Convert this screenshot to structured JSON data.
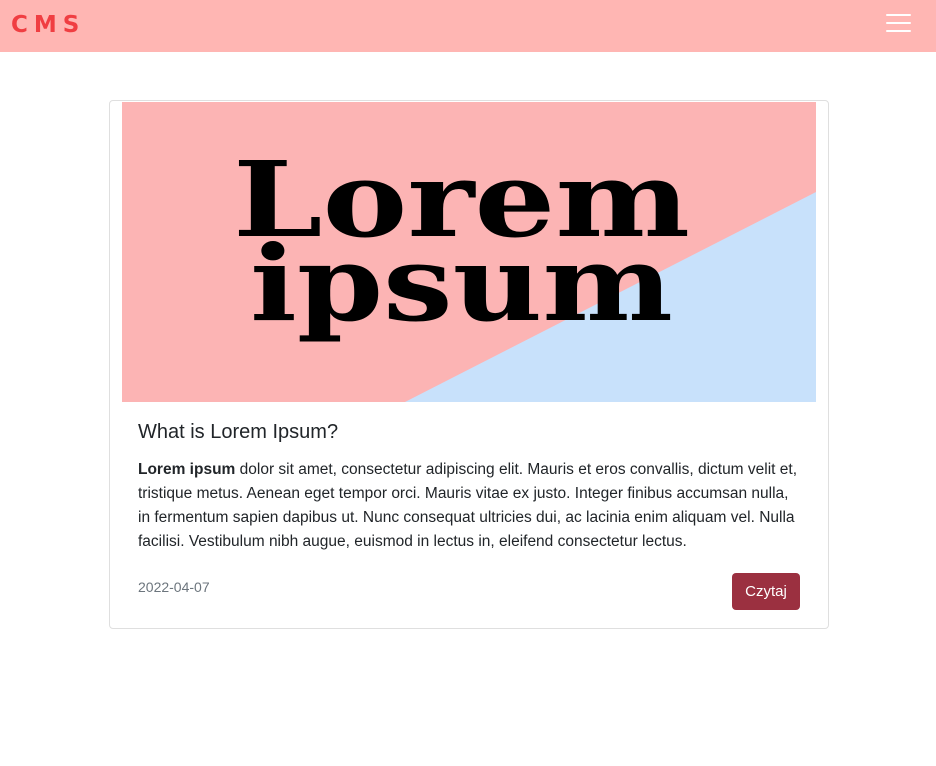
{
  "navbar": {
    "brand": "CMS",
    "menu_icon": "hamburger-menu-icon",
    "background_color": "#ffb6b3",
    "brand_color": "#f03e42"
  },
  "post": {
    "image": {
      "text_line1": "Lorem",
      "text_line2": "ipsum",
      "pink_color": "#fcb4b4",
      "blue_color": "#c8e1fb"
    },
    "title": "What is Lorem Ipsum?",
    "excerpt_bold": "Lorem ipsum",
    "excerpt_rest": " dolor sit amet, consectetur adipiscing elit. Mauris et eros convallis, dictum velit et, tristique metus. Aenean eget tempor orci. Mauris vitae ex justo. Integer finibus accumsan nulla, in fermentum sapien dapibus ut. Nunc consequat ultricies dui, ac lacinia enim aliquam vel. Nulla facilisi. Vestibulum nibh augue, euismod in lectus in, eleifend consectetur lectus.",
    "date": "2022-04-07",
    "read_button": "Czytaj",
    "button_color": "#9b3040"
  }
}
